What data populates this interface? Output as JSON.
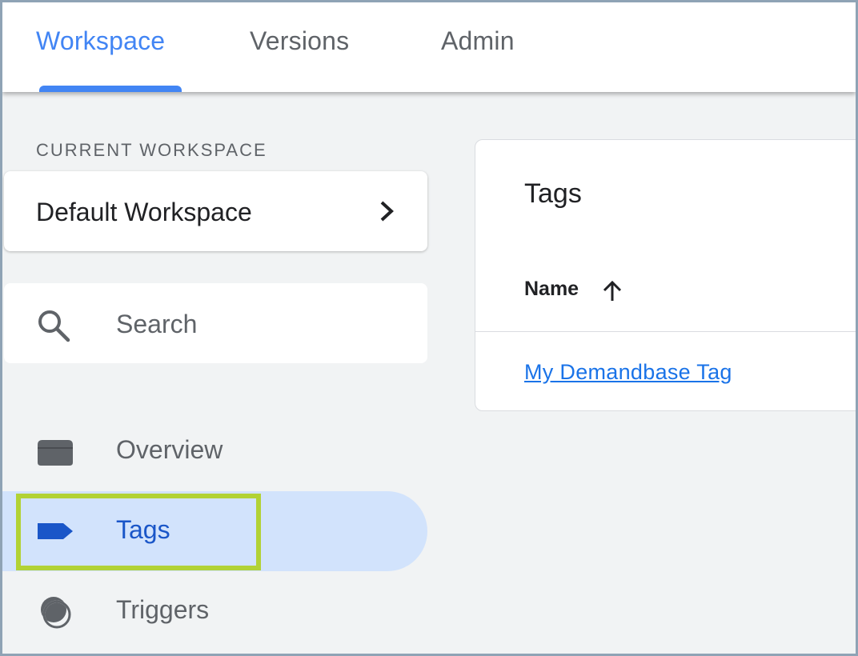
{
  "tabs": [
    {
      "label": "Workspace",
      "active": true
    },
    {
      "label": "Versions",
      "active": false
    },
    {
      "label": "Admin",
      "active": false
    }
  ],
  "sidebar": {
    "workspace_caption": "CURRENT WORKSPACE",
    "workspace_name": "Default Workspace",
    "search_placeholder": "Search",
    "nav": [
      {
        "label": "Overview",
        "icon": "folder-icon",
        "active": false
      },
      {
        "label": "Tags",
        "icon": "tag-icon",
        "active": true
      },
      {
        "label": "Triggers",
        "icon": "trigger-icon",
        "active": false
      }
    ]
  },
  "tags_panel": {
    "title": "Tags",
    "column_header": "Name",
    "sort_direction": "ascending",
    "rows": [
      {
        "name": "My Demandbase Tag"
      }
    ]
  },
  "colors": {
    "accent": "#4285f4",
    "active_nav_bg": "#d2e3fc",
    "active_nav_text": "#1a56c8",
    "highlight": "#b2d235",
    "link": "#1a73e8"
  }
}
